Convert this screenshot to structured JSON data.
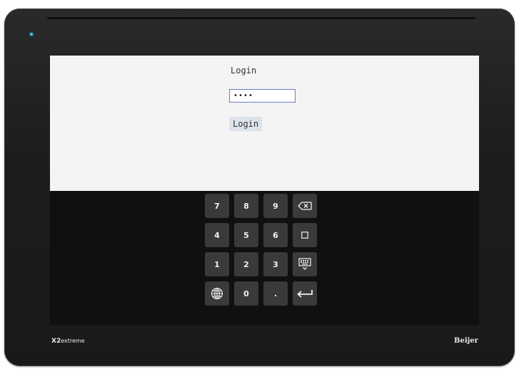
{
  "device": {
    "model_prefix": "X2",
    "model_suffix": "extreme",
    "manufacturer": "Beijer"
  },
  "login": {
    "title": "Login",
    "password_value": "••••",
    "button_label": "Login"
  },
  "keypad": {
    "keys": {
      "k7": "7",
      "k8": "8",
      "k9": "9",
      "k4": "4",
      "k5": "5",
      "k6": "6",
      "k1": "1",
      "k2": "2",
      "k3": "3",
      "k0": "0",
      "kdot": "."
    },
    "icons": {
      "backspace": "backspace-icon",
      "clear": "clear-square-icon",
      "hide_keyboard": "keyboard-hide-icon",
      "language": "globe-icon",
      "enter": "enter-icon"
    }
  },
  "colors": {
    "led": "#39c6d8",
    "input_border": "#6b7fbf",
    "button_bg": "#dde3ea",
    "key_bg": "#3a3a3a"
  }
}
